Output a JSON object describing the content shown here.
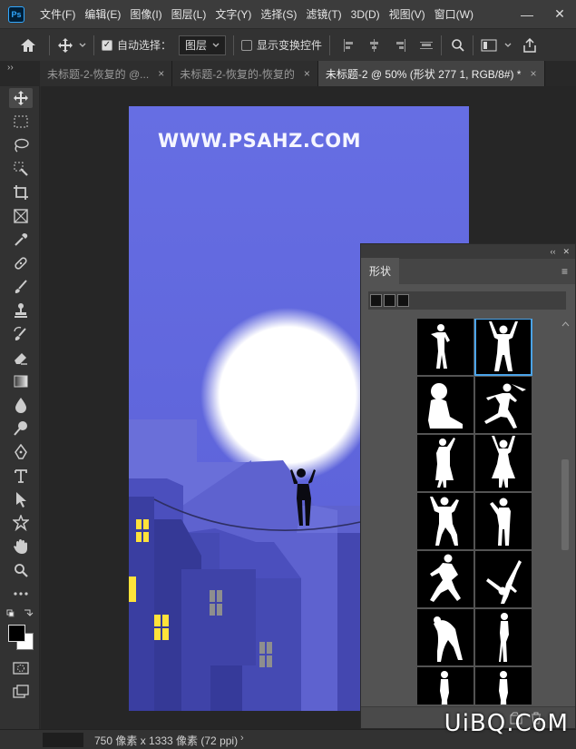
{
  "app": {
    "logo_text": "Ps"
  },
  "menu": [
    "文件(F)",
    "编辑(E)",
    "图像(I)",
    "图层(L)",
    "文字(Y)",
    "选择(S)",
    "滤镜(T)",
    "3D(D)",
    "视图(V)",
    "窗口(W)"
  ],
  "window_controls": {
    "minimize": "—",
    "close": "✕"
  },
  "options": {
    "auto_select_label": "自动选择：",
    "auto_select_value": "图层",
    "show_transform_label": "显示变换控件"
  },
  "tabs": [
    {
      "label": "未标题-2-恢复的 @...",
      "close": "×"
    },
    {
      "label": "未标题-2-恢复的-恢复的",
      "close": "×"
    },
    {
      "label": "未标题-2 @ 50% (形状 277 1, RGB/8#) *",
      "close": "×"
    }
  ],
  "tab_collapse": "››",
  "canvas": {
    "watermark": "WWW.PSAHZ.COM"
  },
  "panel": {
    "top_controls": {
      "collapse": "‹‹",
      "close": "✕"
    },
    "tab_label": "形状",
    "menu_icon": "≡"
  },
  "status": {
    "doc_size": "750 像素 x 1333 像素 (72 ppi)",
    "arrow": "›"
  },
  "site_mark": "UiBQ.CoM",
  "colors": {
    "accent": "#31a8ff",
    "selection": "#4aa3e8",
    "sky": "#5f66dc",
    "moon": "#ffffff",
    "window_light": "#ffe23a"
  }
}
